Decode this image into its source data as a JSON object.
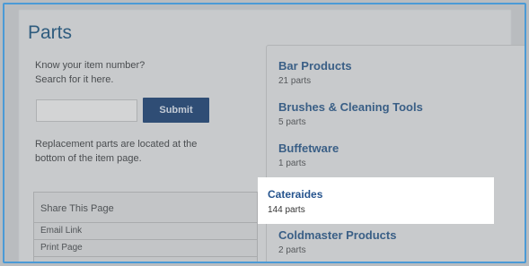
{
  "page": {
    "title": "Parts"
  },
  "search": {
    "prompt_line1": "Know your item number?",
    "prompt_line2": "Search for it here.",
    "input_value": "",
    "submit_label": "Submit",
    "note_line1": "Replacement parts are located at the",
    "note_line2": "bottom of the item page."
  },
  "share": {
    "heading": "Share This Page",
    "items": [
      "Email Link",
      "Print Page"
    ]
  },
  "categories": [
    {
      "name": "Bar Products",
      "count": "21 parts"
    },
    {
      "name": "Brushes & Cleaning Tools",
      "count": "5 parts"
    },
    {
      "name": "Buffetware",
      "count": "1 parts"
    },
    {
      "name": "Cateraides",
      "count": "144 parts",
      "highlighted": true
    },
    {
      "name": "Coldmaster Products",
      "count": "2 parts"
    }
  ],
  "colors": {
    "frame_border": "#4b9ad6",
    "title": "#2f5c7e",
    "submit_bg": "#2f4d75",
    "link": "#3a5f86",
    "highlight_link": "#26548e"
  }
}
